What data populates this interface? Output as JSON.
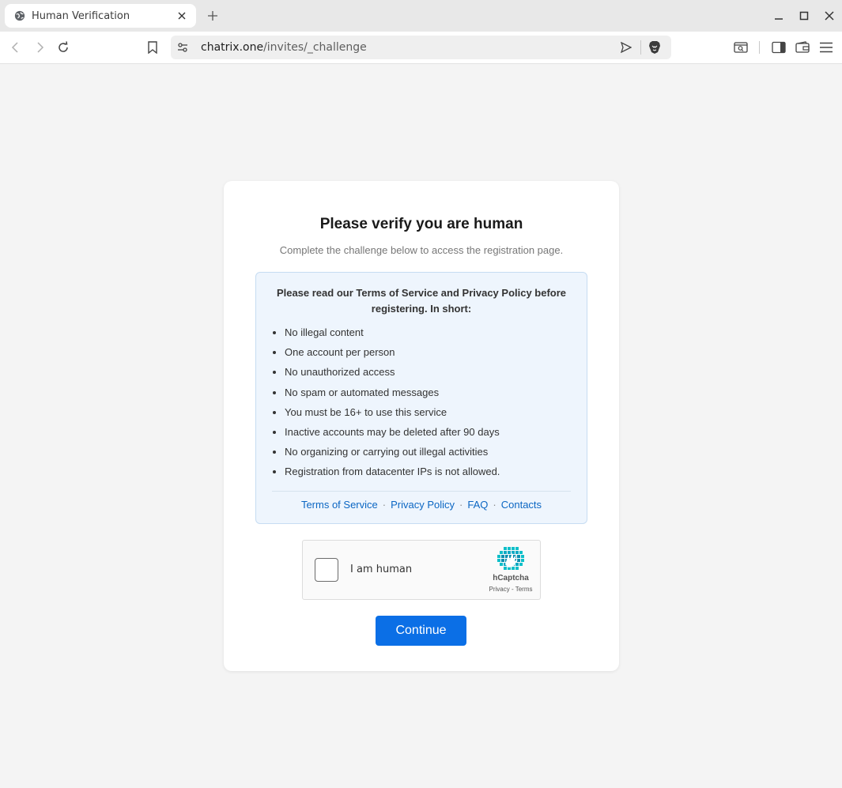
{
  "browser": {
    "tab_title": "Human Verification",
    "url_host": "chatrix.one",
    "url_path": "/invites/_challenge",
    "icons": {
      "tab_favicon": "globe-icon",
      "tab_close": "close-icon",
      "new_tab": "plus-icon",
      "back": "arrow-left-icon",
      "forward": "arrow-right-icon",
      "reload": "reload-icon",
      "bookmark": "bookmark-icon",
      "site_info": "tune-icon",
      "share": "send-icon",
      "brave_shield": "lion-shield-icon",
      "tab_search": "tab-search-icon",
      "sidebar": "sidebar-icon",
      "wallet": "wallet-icon",
      "menu": "hamburger-icon",
      "minimize": "minimize-icon",
      "maximize": "maximize-icon",
      "close_window": "close-icon"
    }
  },
  "page": {
    "title": "Please verify you are human",
    "subtitle": "Complete the challenge below to access the registration page.",
    "tos": {
      "heading": "Please read our Terms of Service and Privacy Policy before registering. In short:",
      "rules": [
        "No illegal content",
        "One account per person",
        "No unauthorized access",
        "No spam or automated messages",
        "You must be 16+ to use this service",
        "Inactive accounts may be deleted after 90 days",
        "No organizing or carrying out illegal activities",
        "Registration from datacenter IPs is not allowed."
      ],
      "links": {
        "terms": "Terms of Service",
        "privacy": "Privacy Policy",
        "faq": "FAQ",
        "contacts": "Contacts",
        "separator": "·"
      }
    },
    "captcha": {
      "label": "I am human",
      "brand": "hCaptcha",
      "privacy": "Privacy",
      "terms": "Terms",
      "separator": " - "
    },
    "continue_label": "Continue"
  },
  "colors": {
    "accent": "#0b6fe6",
    "link": "#0b66c3",
    "tos_bg": "#eef5fd",
    "page_bg": "#f4f4f4"
  }
}
